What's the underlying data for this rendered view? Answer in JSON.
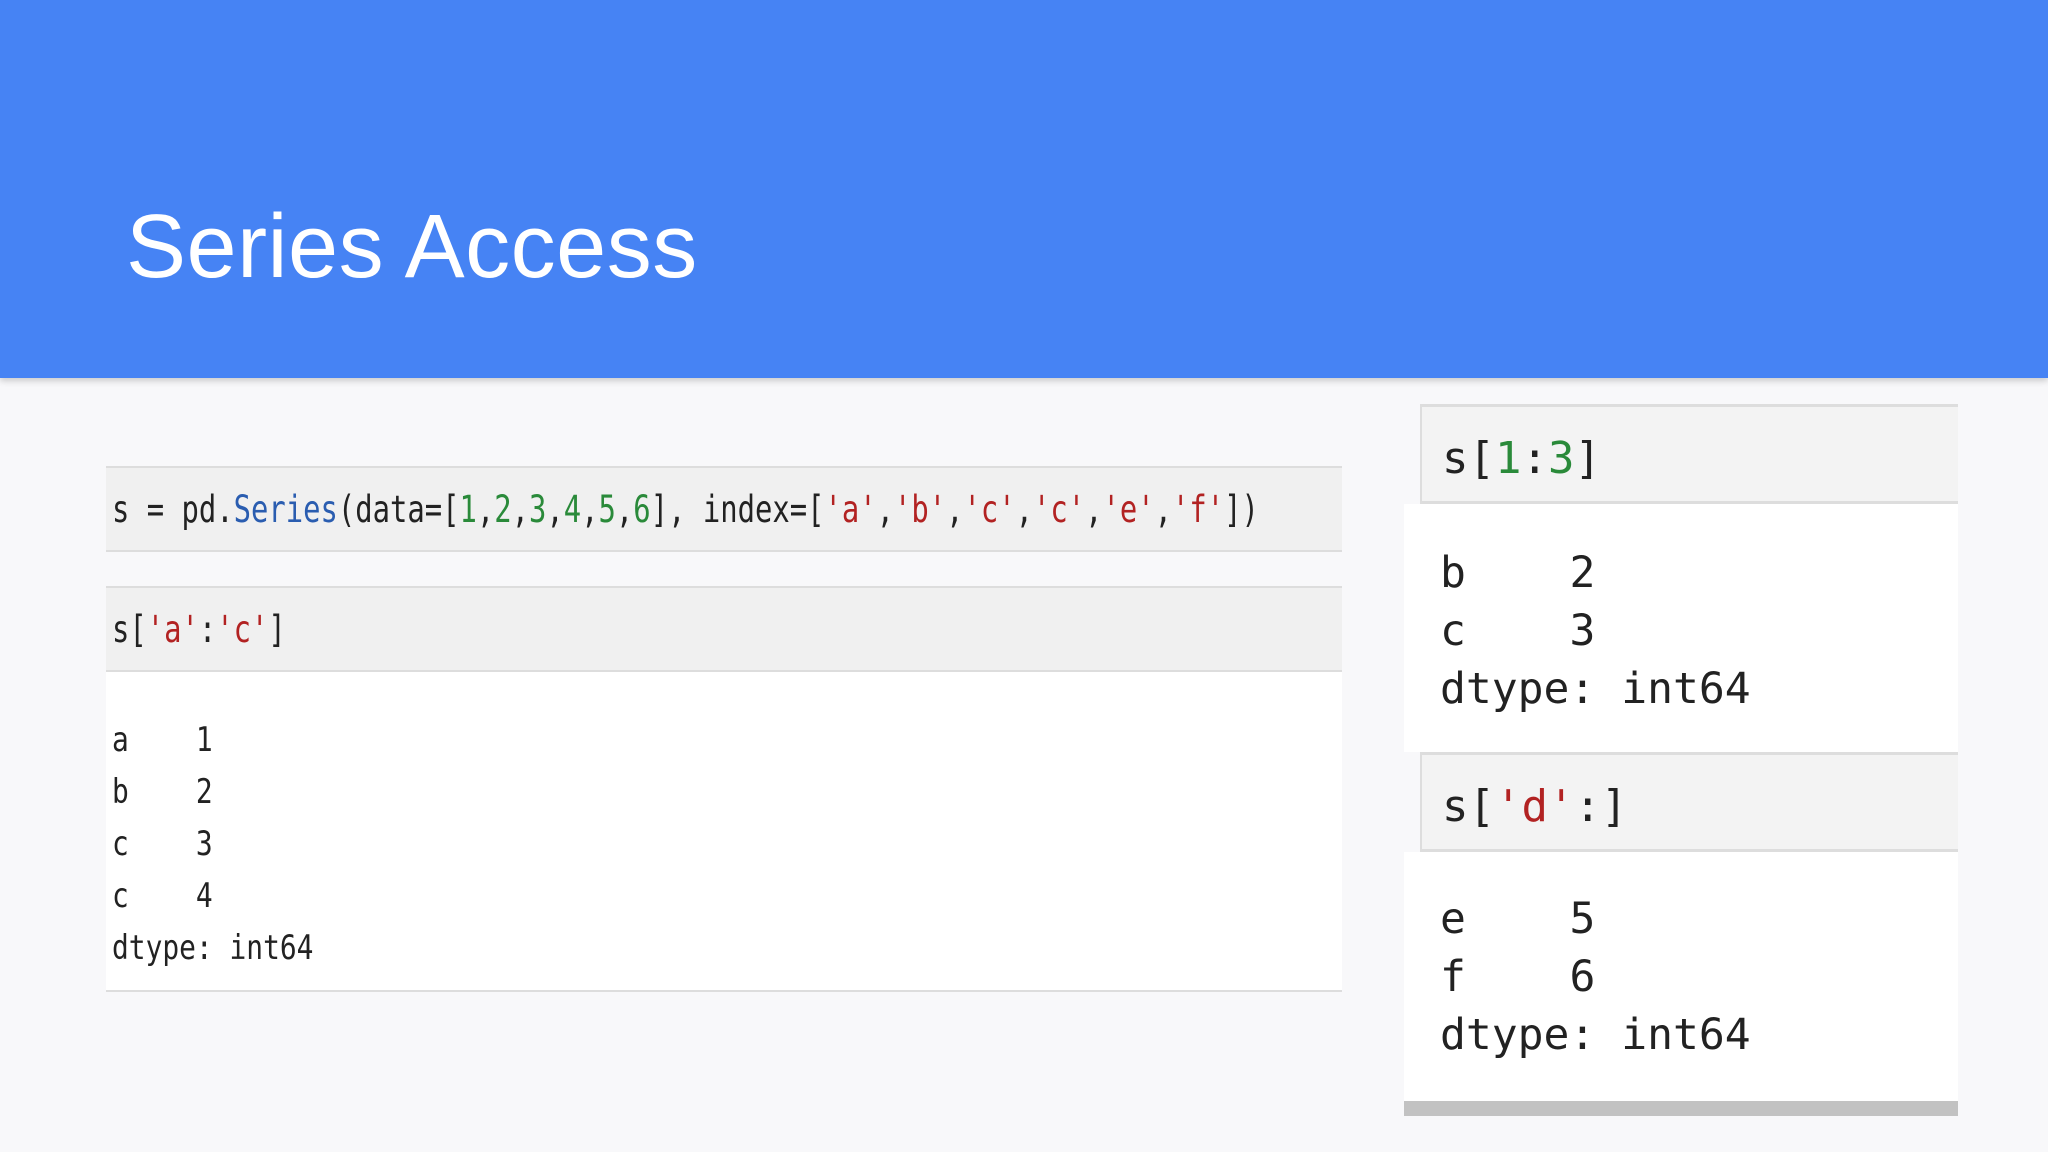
{
  "slide": {
    "title": "Series Access"
  },
  "left_cells": {
    "cell1": {
      "p1": "s = pd.",
      "p2": "Series",
      "p3": "(data=[",
      "p4": "1",
      "p5": ",",
      "p6": "2",
      "p7": ",",
      "p8": "3",
      "p9": ",",
      "p10": "4",
      "p11": ",",
      "p12": "5",
      "p13": ",",
      "p14": "6",
      "p15": "], index=[",
      "p16": "'a'",
      "p17": ",",
      "p18": "'b'",
      "p19": ",",
      "p20": "'c'",
      "p21": ",",
      "p22": "'c'",
      "p23": ",",
      "p24": "'e'",
      "p25": ",",
      "p26": "'f'",
      "p27": "])"
    },
    "cell2": {
      "p1": "s[",
      "p2": "'a'",
      "p3": ":",
      "p4": "'c'",
      "p5": "]"
    },
    "output": [
      "a    1",
      "b    2",
      "c    3",
      "c    4",
      "dtype: int64"
    ]
  },
  "right_cells": {
    "cell1": {
      "p1": "s[",
      "p2": "1",
      "p3": ":",
      "p4": "3",
      "p5": "]"
    },
    "output1": [
      "b    2",
      "c    3",
      "dtype: int64"
    ],
    "cell2": {
      "p1": "s[",
      "p2": "'d'",
      "p3": ":]"
    },
    "output2": [
      "e    5",
      "f    6",
      "dtype: int64"
    ]
  },
  "colors": {
    "header": "#4683f4",
    "keyword": "#2a5db0",
    "number": "#2a8a3a",
    "string": "#b22222"
  }
}
